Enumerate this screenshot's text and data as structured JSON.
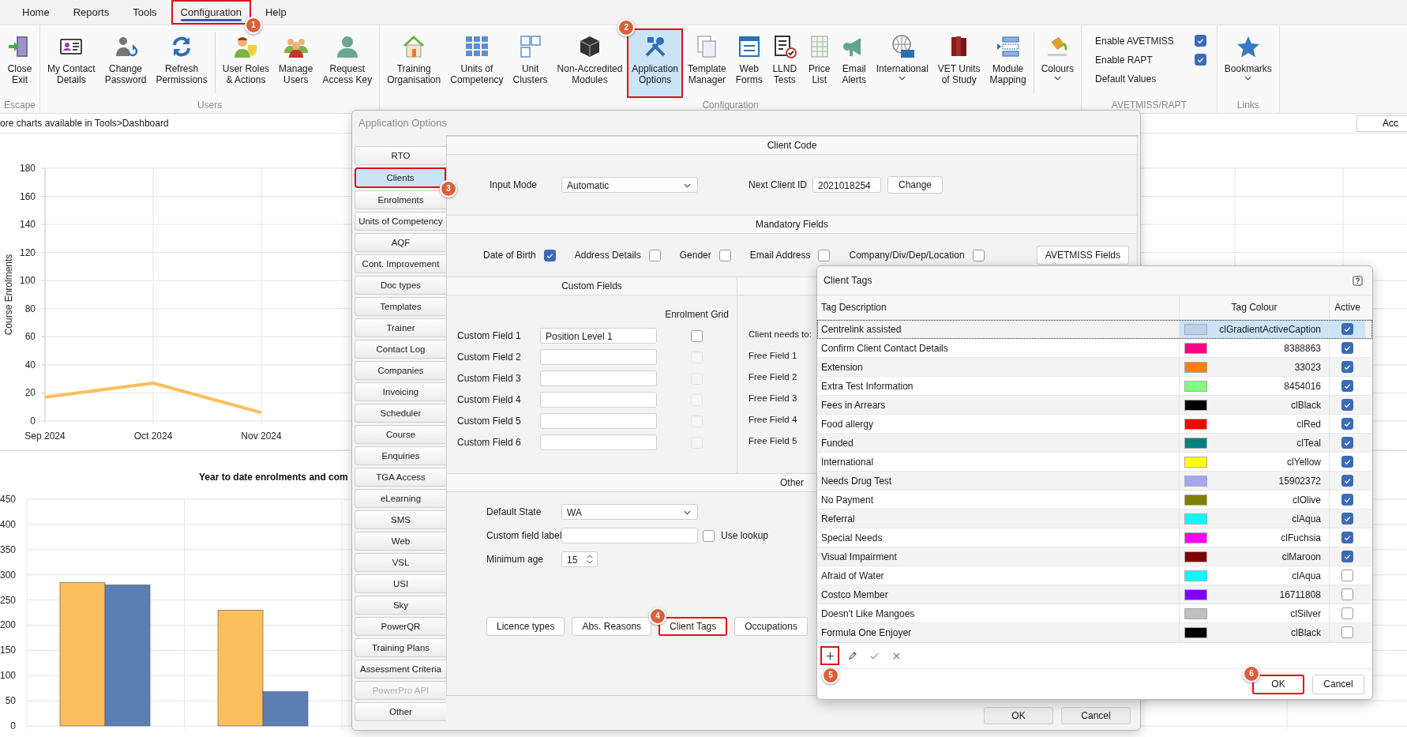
{
  "menu": [
    {
      "label": "Home",
      "selected": false,
      "highlighted": false
    },
    {
      "label": "Reports",
      "selected": false,
      "highlighted": false
    },
    {
      "label": "Tools",
      "selected": false,
      "highlighted": false
    },
    {
      "label": "Configuration",
      "selected": true,
      "highlighted": true,
      "badge": "1"
    },
    {
      "label": "Help",
      "selected": false,
      "highlighted": false
    }
  ],
  "ribbon": [
    {
      "kind": "buttons",
      "label": "Escape",
      "sections": [
        [
          {
            "label": "Close\nExit",
            "selected": false,
            "highlighted": false,
            "dropdown": false
          }
        ]
      ]
    },
    {
      "kind": "buttons",
      "label": "Users",
      "sections": [
        [
          {
            "label": "My Contact\nDetails",
            "selected": false,
            "highlighted": false,
            "dropdown": false
          },
          {
            "label": "Change\nPassword",
            "selected": false,
            "highlighted": false,
            "dropdown": false
          },
          {
            "label": "Refresh\nPermissions",
            "selected": false,
            "highlighted": false,
            "dropdown": false
          }
        ],
        [
          {
            "label": "User Roles\n& Actions",
            "selected": false,
            "highlighted": false,
            "dropdown": false
          },
          {
            "label": "Manage\nUsers",
            "selected": false,
            "highlighted": false,
            "dropdown": false
          },
          {
            "label": "Request\nAccess Key",
            "selected": false,
            "highlighted": false,
            "dropdown": false
          }
        ]
      ]
    },
    {
      "kind": "buttons",
      "label": "Configuration",
      "sections": [
        [
          {
            "label": "Training\nOrganisation",
            "selected": false,
            "highlighted": false,
            "dropdown": false
          },
          {
            "label": "Units of\nCompetency",
            "selected": false,
            "highlighted": false,
            "dropdown": false
          },
          {
            "label": "Unit\nClusters",
            "selected": false,
            "highlighted": false,
            "dropdown": false
          },
          {
            "label": "Non-Accredited\nModules",
            "selected": false,
            "highlighted": false,
            "dropdown": false
          },
          {
            "label": "Application\nOptions",
            "selected": true,
            "highlighted": true,
            "dropdown": false,
            "badge": "2"
          },
          {
            "label": "Template\nManager",
            "selected": false,
            "highlighted": false,
            "dropdown": false
          },
          {
            "label": "Web\nForms",
            "selected": false,
            "highlighted": false,
            "dropdown": false
          },
          {
            "label": "LLND\nTests",
            "selected": false,
            "highlighted": false,
            "dropdown": false
          },
          {
            "label": "Price\nList",
            "selected": false,
            "highlighted": false,
            "dropdown": false
          },
          {
            "label": "Email\nAlerts",
            "selected": false,
            "highlighted": false,
            "dropdown": false
          },
          {
            "label": "International",
            "selected": false,
            "highlighted": false,
            "dropdown": true
          },
          {
            "label": "VET Units\nof Study",
            "selected": false,
            "highlighted": false,
            "dropdown": false
          },
          {
            "label": "Module\nMapping",
            "selected": false,
            "highlighted": false,
            "dropdown": false
          }
        ],
        [
          {
            "label": "Colours",
            "selected": false,
            "highlighted": false,
            "dropdown": true
          }
        ]
      ]
    },
    {
      "kind": "checks",
      "label": "AVETMISS/RAPT",
      "checks": [
        {
          "label": "Enable AVETMISS",
          "checked": true
        },
        {
          "label": "Enable RAPT",
          "checked": true
        }
      ],
      "link": "Default Values"
    },
    {
      "kind": "buttons",
      "label": "Links",
      "sections": [
        [
          {
            "label": "Bookmarks",
            "selected": false,
            "highlighted": false,
            "dropdown": true
          }
        ]
      ]
    }
  ],
  "dashboard": {
    "info": "ore charts available in Tools>Dashboard",
    "button": "Acc",
    "line_chart": {
      "chart_data": {
        "type": "line",
        "ylabel": "Course Enrolments",
        "categories": [
          "Sep 2024",
          "Oct 2024",
          "Nov 2024"
        ],
        "series": [
          {
            "color": "#fdbe5c",
            "values": [
              17,
              27,
              6
            ]
          }
        ],
        "ylim": [
          0,
          180
        ],
        "grid": true,
        "yticks": [
          0,
          20,
          40,
          60,
          80,
          100,
          120,
          140,
          160,
          180
        ]
      }
    },
    "bar_chart": {
      "chart_data": {
        "type": "bar",
        "title": "Year to date enrolments and com",
        "series": [
          {
            "color": "#fdbe5c",
            "values": [
              285,
              230
            ]
          },
          {
            "color": "#5b7fb3",
            "values": [
              280,
              68
            ]
          }
        ],
        "ylim": [
          0,
          450
        ],
        "grid": true,
        "yticks": [
          0,
          50,
          100,
          150,
          200,
          250,
          300,
          350,
          400,
          450
        ]
      }
    }
  },
  "app_options": {
    "title": "Application Options",
    "tabs": [
      {
        "label": "RTO",
        "selected": false,
        "disabled": false,
        "highlighted": false
      },
      {
        "label": "Clients",
        "selected": true,
        "disabled": false,
        "highlighted": true,
        "badge": "3"
      },
      {
        "label": "Enrolments",
        "selected": false,
        "disabled": false,
        "highlighted": false
      },
      {
        "label": "Units of Competency",
        "selected": false,
        "disabled": false,
        "highlighted": false
      },
      {
        "label": "AQF",
        "selected": false,
        "disabled": false,
        "highlighted": false
      },
      {
        "label": "Cont. Improvement",
        "selected": false,
        "disabled": false,
        "highlighted": false
      },
      {
        "label": "Doc types",
        "selected": false,
        "disabled": false,
        "highlighted": false
      },
      {
        "label": "Templates",
        "selected": false,
        "disabled": false,
        "highlighted": false
      },
      {
        "label": "Trainer",
        "selected": false,
        "disabled": false,
        "highlighted": false
      },
      {
        "label": "Contact Log",
        "selected": false,
        "disabled": false,
        "highlighted": false
      },
      {
        "label": "Companies",
        "selected": false,
        "disabled": false,
        "highlighted": false
      },
      {
        "label": "Invoicing",
        "selected": false,
        "disabled": false,
        "highlighted": false
      },
      {
        "label": "Scheduler",
        "selected": false,
        "disabled": false,
        "highlighted": false
      },
      {
        "label": "Course",
        "selected": false,
        "disabled": false,
        "highlighted": false
      },
      {
        "label": "Enquiries",
        "selected": false,
        "disabled": false,
        "highlighted": false
      },
      {
        "label": "TGA Access",
        "selected": false,
        "disabled": false,
        "highlighted": false
      },
      {
        "label": "eLearning",
        "selected": false,
        "disabled": false,
        "highlighted": false
      },
      {
        "label": "SMS",
        "selected": false,
        "disabled": false,
        "highlighted": false
      },
      {
        "label": "Web",
        "selected": false,
        "disabled": false,
        "highlighted": false
      },
      {
        "label": "VSL",
        "selected": false,
        "disabled": false,
        "highlighted": false
      },
      {
        "label": "USI",
        "selected": false,
        "disabled": false,
        "highlighted": false
      },
      {
        "label": "Sky",
        "selected": false,
        "disabled": false,
        "highlighted": false
      },
      {
        "label": "PowerQR",
        "selected": false,
        "disabled": false,
        "highlighted": false
      },
      {
        "label": "Training Plans",
        "selected": false,
        "disabled": false,
        "highlighted": false
      },
      {
        "label": "Assessment Criteria",
        "selected": false,
        "disabled": false,
        "highlighted": false
      },
      {
        "label": "PowerPro API",
        "selected": false,
        "disabled": true,
        "highlighted": false
      },
      {
        "label": "Other",
        "selected": false,
        "disabled": false,
        "highlighted": false
      }
    ],
    "client_code": {
      "heading": "Client Code",
      "input_mode_label": "Input Mode",
      "input_mode": "Automatic",
      "next_id_label": "Next Client ID",
      "next_id": "2021018254",
      "change_button": "Change"
    },
    "mandatory": {
      "heading": "Mandatory Fields",
      "fields": [
        {
          "label": "Date of Birth",
          "checked": true
        },
        {
          "label": "Address Details",
          "checked": false
        },
        {
          "label": "Gender",
          "checked": false
        },
        {
          "label": "Email Address",
          "checked": false
        },
        {
          "label": "Company/Div/Dep/Location",
          "checked": false
        }
      ],
      "button": "AVETMISS Fields"
    },
    "custom_fields": {
      "heading": "Custom Fields",
      "grid_heading": "Enrolment Grid",
      "rows": [
        {
          "label": "Custom Field 1",
          "value": "Position Level 1",
          "grid_checked": false,
          "grid_disabled": false
        },
        {
          "label": "Custom Field 2",
          "grid_checked": false,
          "grid_disabled": true
        },
        {
          "label": "Custom Field 3",
          "grid_checked": false,
          "grid_disabled": true
        },
        {
          "label": "Custom Field 4",
          "grid_checked": false,
          "grid_disabled": true
        },
        {
          "label": "Custom Field 5",
          "grid_checked": false,
          "grid_disabled": true
        },
        {
          "label": "Custom Field 6",
          "grid_checked": false,
          "grid_disabled": true
        }
      ]
    },
    "free_fields": [
      "Client needs to:",
      "Free Field 1",
      "Free Field 2",
      "Free Field 3",
      "Free Field 4",
      "Free Field 5"
    ],
    "other": {
      "heading": "Other",
      "default_state_label": "Default State",
      "default_state": "WA",
      "custom_label_label": "Custom field label",
      "use_lookup": {
        "label": "Use lookup",
        "checked": false
      },
      "min_age_label": "Minimum age",
      "min_age": "15",
      "buttons": [
        {
          "label": "Licence types",
          "highlighted": false
        },
        {
          "label": "Abs. Reasons",
          "highlighted": false
        },
        {
          "label": "Client Tags",
          "highlighted": true,
          "badge": "4"
        },
        {
          "label": "Occupations",
          "highlighted": false
        }
      ]
    },
    "buttons": [
      "OK",
      "Cancel"
    ]
  },
  "client_tags": {
    "title": "Client Tags",
    "columns": [
      "Tag Description",
      "Tag Colour",
      "Active"
    ],
    "rows": [
      {
        "description": "Centrelink assisted",
        "colour": "clGradientActiveCaption",
        "color": "#b9d1ea",
        "active": true,
        "selected": true
      },
      {
        "description": "Confirm Client Contact Details",
        "colour": "8388863",
        "color": "#ff0080",
        "active": true,
        "selected": false
      },
      {
        "description": "Extension",
        "colour": "33023",
        "color": "#ff8000",
        "active": true,
        "selected": false
      },
      {
        "description": "Extra Test Information",
        "colour": "8454016",
        "color": "#80ff80",
        "active": true,
        "selected": false
      },
      {
        "description": "Fees in Arrears",
        "colour": "clBlack",
        "color": "#000000",
        "active": true,
        "selected": false
      },
      {
        "description": "Food allergy",
        "colour": "clRed",
        "color": "#ff0000",
        "active": true,
        "selected": false
      },
      {
        "description": "Funded",
        "colour": "clTeal",
        "color": "#008080",
        "active": true,
        "selected": false
      },
      {
        "description": "International",
        "colour": "clYellow",
        "color": "#ffff00",
        "active": true,
        "selected": false
      },
      {
        "description": "Needs Drug Test",
        "colour": "15902372",
        "color": "#a4a6f2",
        "active": true,
        "selected": false
      },
      {
        "description": "No Payment",
        "colour": "clOlive",
        "color": "#808000",
        "active": true,
        "selected": false
      },
      {
        "description": "Referral",
        "colour": "clAqua",
        "color": "#00ffff",
        "active": true,
        "selected": false
      },
      {
        "description": "Special Needs",
        "colour": "clFuchsia",
        "color": "#ff00ff",
        "active": true,
        "selected": false
      },
      {
        "description": "Visual Impairment",
        "colour": "clMaroon",
        "color": "#800000",
        "active": true,
        "selected": false
      },
      {
        "description": "Afraid of Water",
        "colour": "clAqua",
        "color": "#00ffff",
        "active": false,
        "selected": false
      },
      {
        "description": "Costco Member",
        "colour": "16711808",
        "color": "#8000ff",
        "active": false,
        "selected": false
      },
      {
        "description": "Doesn't Like Mangoes",
        "colour": "clSilver",
        "color": "#c0c0c0",
        "active": false,
        "selected": false
      },
      {
        "description": "Formula One Enjoyer",
        "colour": "clBlack",
        "color": "#000000",
        "active": false,
        "selected": false
      }
    ],
    "toolbar": [
      {
        "kind": "add",
        "highlighted": true,
        "badge": "5"
      },
      {
        "kind": "edit",
        "highlighted": false
      },
      {
        "kind": "confirm",
        "highlighted": false
      },
      {
        "kind": "cancel",
        "highlighted": false
      }
    ],
    "buttons": [
      {
        "label": "OK",
        "highlighted": true,
        "badge": "6"
      },
      {
        "label": "Cancel",
        "highlighted": false
      }
    ]
  }
}
